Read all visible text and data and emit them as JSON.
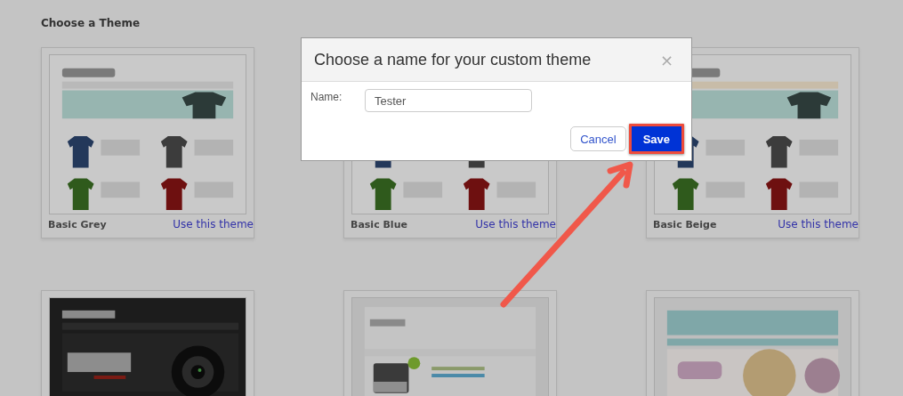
{
  "heading": "Choose a Theme",
  "themes": [
    {
      "name": "Basic Grey",
      "action": "Use this theme",
      "preview": {
        "kind": "picture"
      }
    },
    {
      "name": "Basic Blue",
      "action": "Use this theme",
      "preview": {
        "kind": "picture"
      }
    },
    {
      "name": "Basic Beige",
      "action": "Use this theme",
      "preview": {
        "kind": "picture"
      }
    },
    {
      "preview": {
        "kind": "picture"
      }
    },
    {
      "preview": {
        "kind": "picture"
      }
    },
    {
      "preview": {
        "kind": "picture"
      }
    }
  ],
  "dialog": {
    "title": "Choose a name for your custom theme",
    "close": "×",
    "fields": [
      {
        "label": "Name:",
        "value": "Tester"
      }
    ],
    "buttons": [
      {
        "label": "Cancel",
        "kind": "secondary",
        "highlighted": false
      },
      {
        "label": "Save",
        "kind": "primary",
        "highlighted": true
      }
    ]
  }
}
